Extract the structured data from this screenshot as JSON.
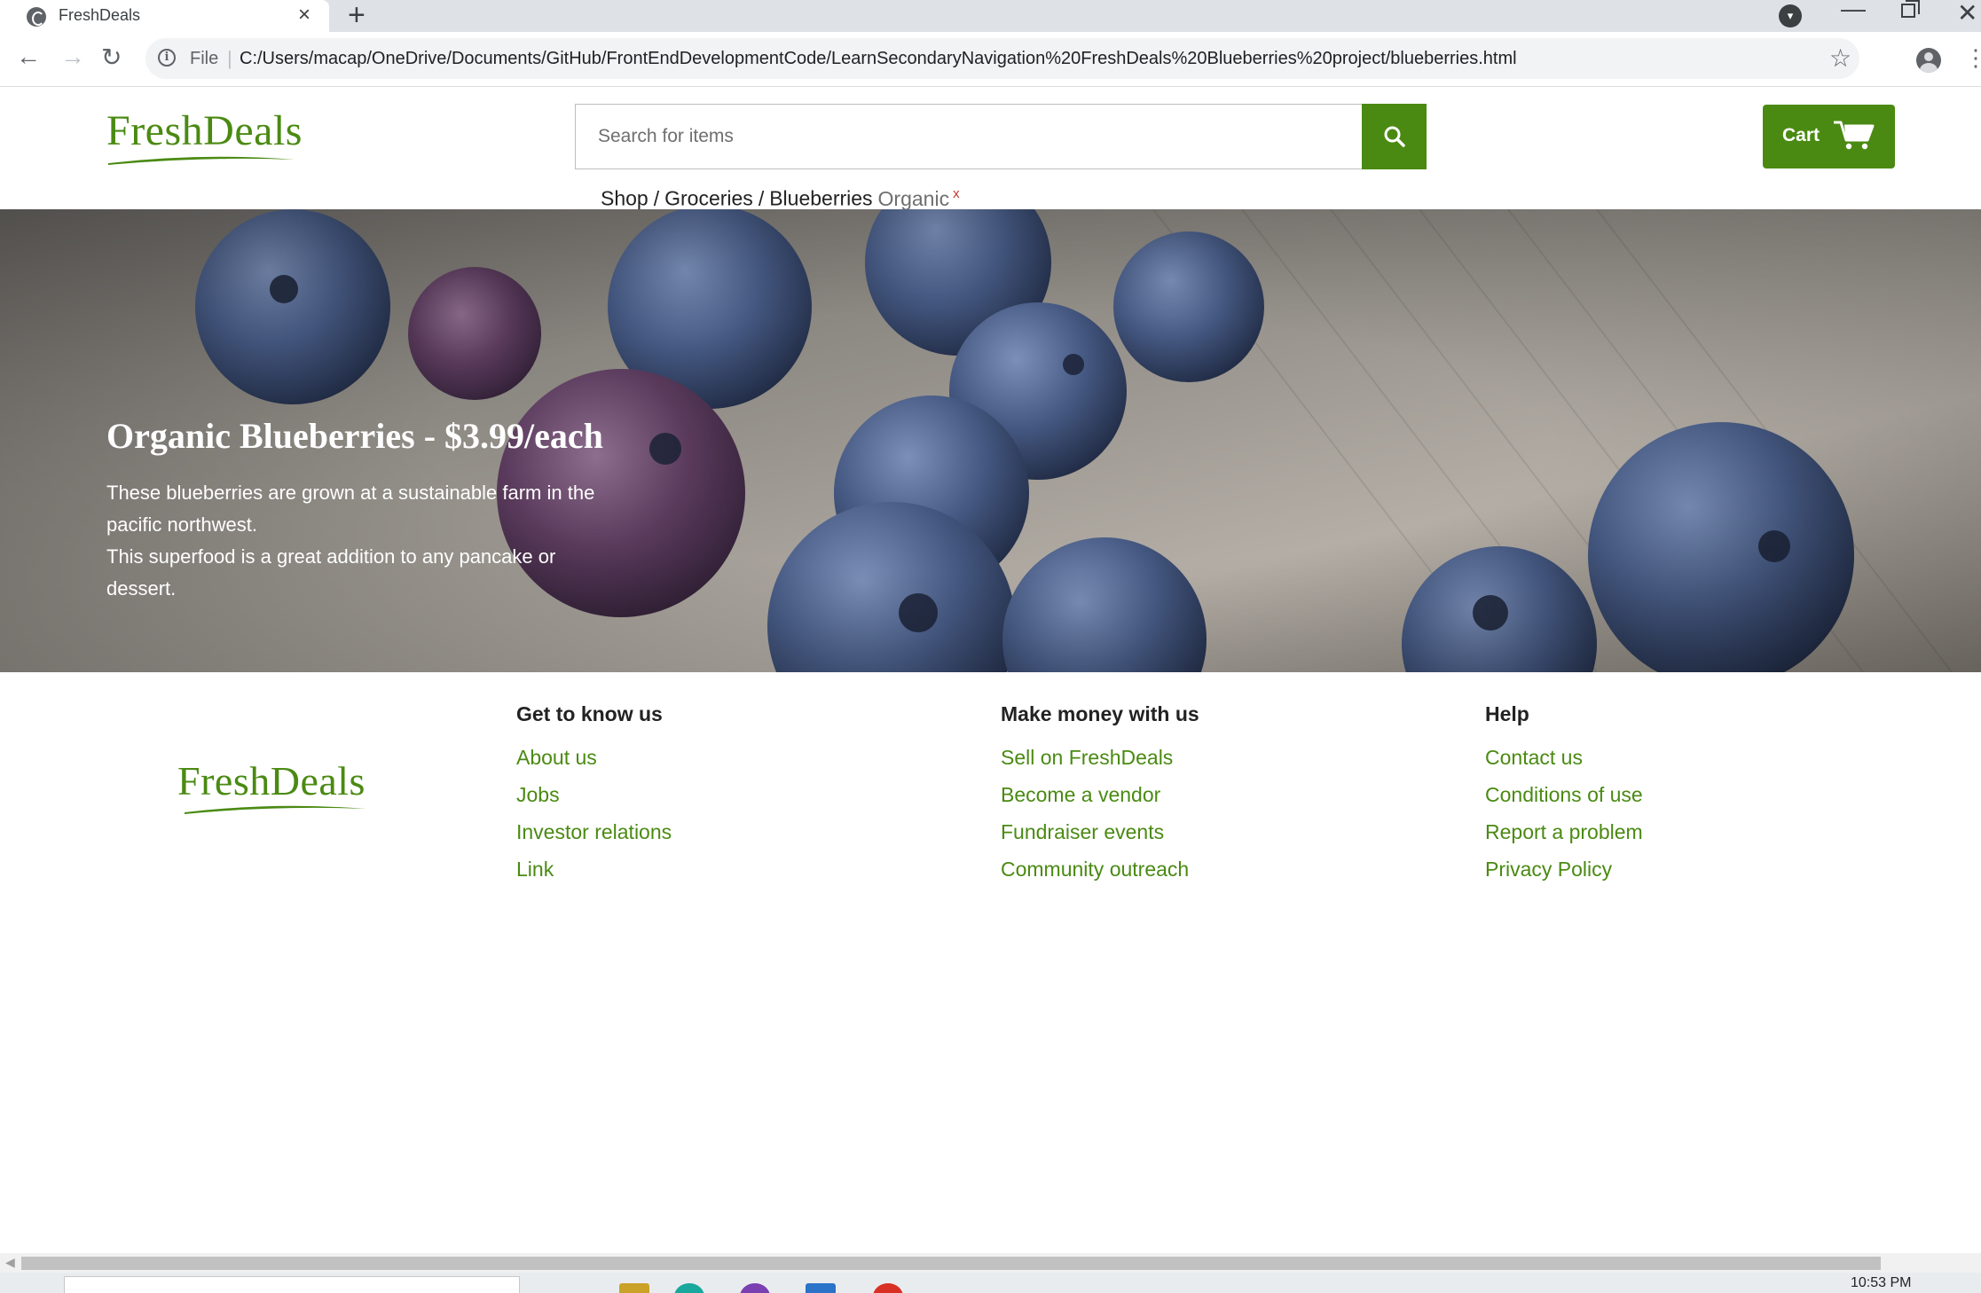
{
  "browser": {
    "tab_title": "FreshDeals",
    "tab_close": "×",
    "new_tab": "+",
    "url_scheme": "File",
    "url": "C:/Users/macap/OneDrive/Documents/GitHub/FrontEndDevelopmentCode/LearnSecondaryNavigation%20FreshDeals%20Blueberries%20project/blueberries.html"
  },
  "header": {
    "logo": "FreshDeals",
    "search_placeholder": "Search for items",
    "cart_label": "Cart"
  },
  "breadcrumb": {
    "items": [
      "Shop",
      "Groceries",
      "Blueberries"
    ],
    "separator": "/",
    "current": "Organic",
    "remove": "x"
  },
  "hero": {
    "title": "Organic Blueberries - $3.99/each",
    "description_line1": "These blueberries are grown at a sustainable farm in the pacific northwest.",
    "description_line2": "This superfood is a great addition to any pancake or dessert."
  },
  "footer": {
    "logo": "FreshDeals",
    "columns": [
      {
        "heading": "Get to know us",
        "links": [
          "About us",
          "Jobs",
          "Investor relations",
          "Link"
        ]
      },
      {
        "heading": "Make money with us",
        "links": [
          "Sell on FreshDeals",
          "Become a vendor",
          "Fundraiser events",
          "Community outreach"
        ]
      },
      {
        "heading": "Help",
        "links": [
          "Contact us",
          "Conditions of use",
          "Report a problem",
          "Privacy Policy"
        ]
      }
    ]
  },
  "taskbar": {
    "clock": "10:53 PM"
  },
  "colors": {
    "brand_green": "#4a8a12",
    "breadcrumb_remove": "#c0392b"
  }
}
